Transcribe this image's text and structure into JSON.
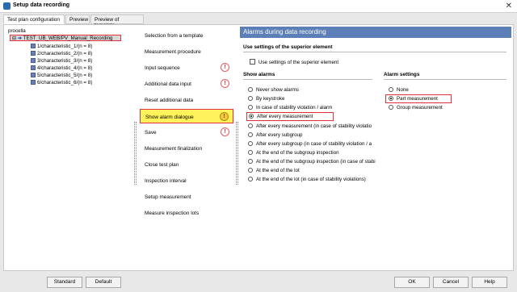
{
  "window": {
    "title": "Setup data recording"
  },
  "tabs": [
    "Test plan configuration",
    "Preview",
    "Preview of template"
  ],
  "tree": {
    "root": "procella",
    "plan": "TEST_UB_WEB/PV_Manual_Recording",
    "children": [
      "1/characteristic_1/(n = 8)",
      "2/characteristic_2/(n = 8)",
      "3/characteristic_3/(n = 8)",
      "4/characteristic_4/(n = 8)",
      "5/characteristic_5/(n = 8)",
      "6/characteristic_6/(n = 8)"
    ]
  },
  "nav": [
    {
      "label": "Selection from a template",
      "warn": false
    },
    {
      "label": "Measurement procedure",
      "warn": false
    },
    {
      "label": "Input sequence",
      "warn": true
    },
    {
      "label": "Additional data input",
      "warn": true
    },
    {
      "label": "Reset additional data",
      "warn": false
    },
    {
      "label": "Show alarm dialogue",
      "warn": true,
      "active": true
    },
    {
      "label": "Save",
      "warn": true
    },
    {
      "label": "Measurement finalization",
      "warn": false
    },
    {
      "label": "Close test plan",
      "warn": false
    },
    {
      "label": "Inspection interval",
      "warn": false
    },
    {
      "label": "Setup measurement",
      "warn": false
    },
    {
      "label": "Measure inspection lots",
      "warn": false
    }
  ],
  "warn_glyph": "!",
  "panel": {
    "title": "Alarms during data recording",
    "superior_section": "Use settings of the superior element",
    "superior_checkbox": "Use settings of the superior element",
    "show_alarms_title": "Show alarms",
    "show_alarms": [
      "Never show alarms",
      "By keystroke",
      "In case of stability violation / alarm",
      "After every measurement",
      "After every measurement (in case of stability violatio",
      "After every subgroup",
      "After every subgroup (in case of stability violation / a",
      "At the end of the subgroup inspection",
      "At the end of the subgroup inspection (in case of stabi",
      "At the end of the lot",
      "At the end of the lot (in case of stability violations)"
    ],
    "show_alarms_selected": 3,
    "alarm_settings_title": "Alarm settings",
    "alarm_settings": [
      "None",
      "Part measurement",
      "Group measurement"
    ],
    "alarm_settings_selected": 1
  },
  "buttons": {
    "standard": "Standard",
    "default": "Default",
    "ok": "OK",
    "cancel": "Cancel",
    "help": "Help"
  },
  "colors": {
    "header": "#5b7fb6",
    "highlight": "#fff25a",
    "annotation": "#e0303a"
  }
}
